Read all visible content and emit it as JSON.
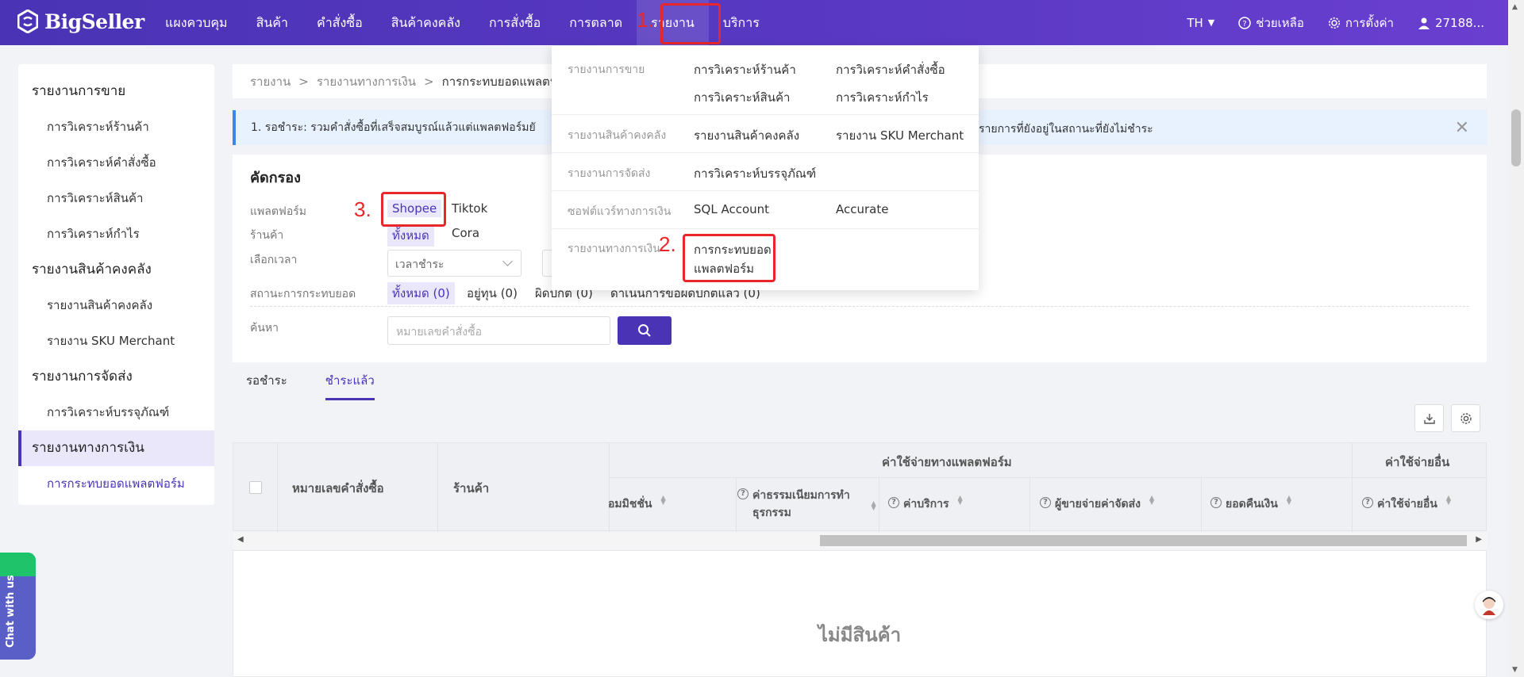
{
  "brand": {
    "name": "BigSeller"
  },
  "nav": {
    "items": [
      "แผงควบคุม",
      "สินค้า",
      "คำสั่งซื้อ",
      "สินค้าคงคลัง",
      "การสั่งซื้อ",
      "การตลาด",
      "รายงาน",
      "บริการ"
    ],
    "lang": "TH",
    "help": "ช่วยเหลือ",
    "settings": "การตั้งค่า",
    "user": "27188..."
  },
  "annotations": {
    "n1": "1.",
    "n2": "2.",
    "n3": "3."
  },
  "sidebar": {
    "g1": "รายงานการขาย",
    "g1_items": [
      "การวิเคราะห์ร้านค้า",
      "การวิเคราะห์คำสั่งซื้อ",
      "การวิเคราะห์สินค้า",
      "การวิเคราะห์กำไร"
    ],
    "g2": "รายงานสินค้าคงคลัง",
    "g2_items": [
      "รายงานสินค้าคงคลัง",
      "รายงาน SKU Merchant"
    ],
    "g3": "รายงานการจัดส่ง",
    "g3_items": [
      "การวิเคราะห์บรรจุภัณฑ์"
    ],
    "g4": "รายงานทางการเงิน",
    "g4_items": [
      "การกระทบยอดแพลตฟอร์ม"
    ]
  },
  "breadcrumb": {
    "a": "รายงาน",
    "b": "รายงานทางการเงิน",
    "c": "การกระทบยอดแพลตฟอ",
    "sep": ">"
  },
  "notice": {
    "text": "1. รอชำระ: รวมคำสั่งซื้อที่เสร็จสมบูรณ์แล้วแต่แพลตฟอร์มยั",
    "text_right": "รายการที่ยังอยู่ในสถานะที่ยังไม่ชำระ",
    "close": "✕"
  },
  "filter": {
    "title": "คัดกรอง",
    "platform_label": "แพลตฟอร์ม",
    "platforms": [
      "Shopee",
      "Tiktok"
    ],
    "store_label": "ร้านค้า",
    "stores": [
      "ทั้งหมด",
      "Cora"
    ],
    "time_label": "เลือกเวลา",
    "time_select": "เวลาชำระ",
    "status_label": "สถานะการกระทบยอด",
    "statuses": [
      "ทั้งหมด (0)",
      "อยู่ทุน (0)",
      "ผิดปกติ (0)",
      "ดำเนินการขอผิดปกติแล้ว (0)"
    ],
    "search_label": "ค้นหา",
    "search_placeholder": "หมายเลขคำสั่งซื้อ"
  },
  "tabs": [
    "รอชำระ",
    "ชำระแล้ว"
  ],
  "table": {
    "order_no": "หมายเลขคำสั่งซื้อ",
    "store": "ร้านค้า",
    "platform_fees": "ค่าใช้จ่ายทางแพลตฟอร์ม",
    "other_fees": "ค่าใช้จ่ายอื่น",
    "sub": [
      "อมมิชชั่น",
      "ค่าธรรมเนียมการทำธุรกรรม",
      "ค่าบริการ",
      "ผู้ขายจ่ายค่าจัดส่ง",
      "ยอดคืนเงิน",
      "ค่าใช้จ่ายอื่น"
    ]
  },
  "empty": "ไม่มีสินค้า",
  "dropdown": {
    "r1_cat": "รายงานการขาย",
    "r1_links": [
      "การวิเคราะห์ร้านค้า",
      "การวิเคราะห์คำสั่งซื้อ",
      "การวิเคราะห์สินค้า",
      "การวิเคราะห์กำไร"
    ],
    "r2_cat": "รายงานสินค้าคงคลัง",
    "r2_links": [
      "รายงานสินค้าคงคลัง",
      "รายงาน SKU Merchant"
    ],
    "r3_cat": "รายงานการจัดส่ง",
    "r3_links": [
      "การวิเคราะห์บรรจุภัณฑ์"
    ],
    "r4_cat": "ซอฟต์แวร์ทางการเงิน",
    "r4_links": [
      "SQL Account",
      "Accurate"
    ],
    "r5_cat": "รายงานทางการเงิน",
    "r5_link_l1": "การกระทบยอด",
    "r5_link_l2": "แพลตฟอร์ม"
  },
  "chat": "Chat with us",
  "colors": {
    "brand": "#4a33b5",
    "annotation": "#e8262b",
    "notice_bg": "#e8f2ff"
  }
}
